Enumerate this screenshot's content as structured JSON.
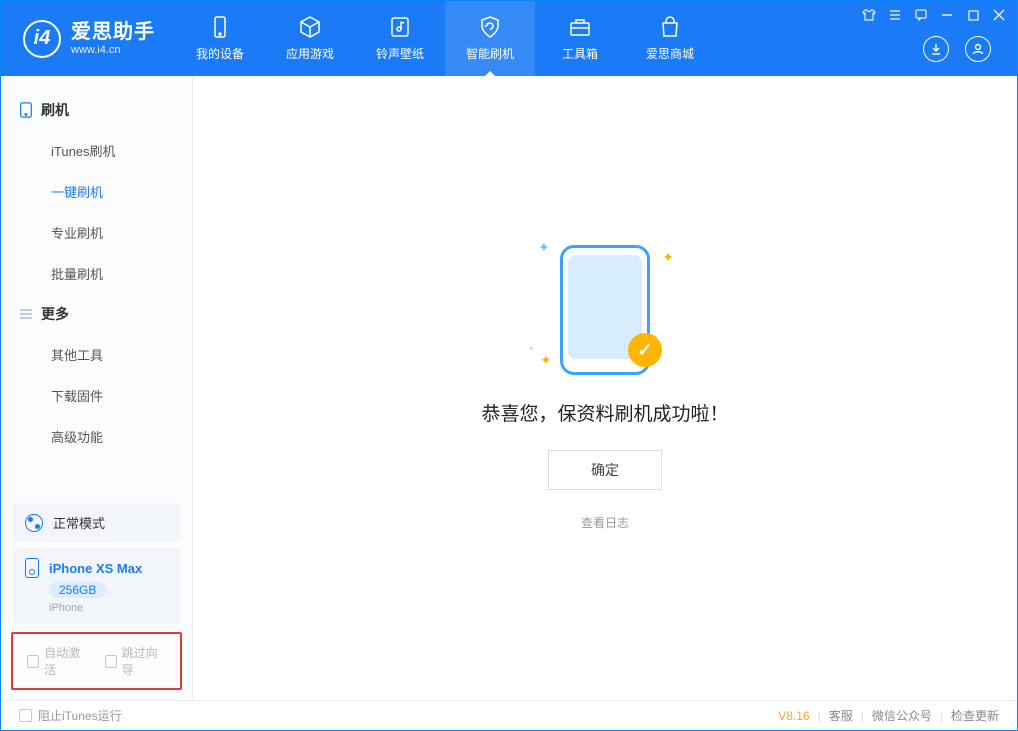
{
  "brand": {
    "name": "爱思助手",
    "url": "www.i4.cn"
  },
  "tabs": [
    {
      "label": "我的设备"
    },
    {
      "label": "应用游戏"
    },
    {
      "label": "铃声壁纸"
    },
    {
      "label": "智能刷机"
    },
    {
      "label": "工具箱"
    },
    {
      "label": "爱思商城"
    }
  ],
  "sidebar": {
    "group1": {
      "title": "刷机",
      "items": [
        "iTunes刷机",
        "一键刷机",
        "专业刷机",
        "批量刷机"
      ]
    },
    "group2": {
      "title": "更多",
      "items": [
        "其他工具",
        "下载固件",
        "高级功能"
      ]
    }
  },
  "mode": {
    "label": "正常模式"
  },
  "device": {
    "name": "iPhone XS Max",
    "capacity": "256GB",
    "type": "iPhone"
  },
  "checkboxes": {
    "auto_activate": "自动激活",
    "skip_guide": "跳过向导"
  },
  "main": {
    "success": "恭喜您，保资料刷机成功啦！",
    "ok": "确定",
    "view_log": "查看日志"
  },
  "footer": {
    "stop_itunes": "阻止iTunes运行",
    "version": "V8.16",
    "links": [
      "客服",
      "微信公众号",
      "检查更新"
    ]
  }
}
